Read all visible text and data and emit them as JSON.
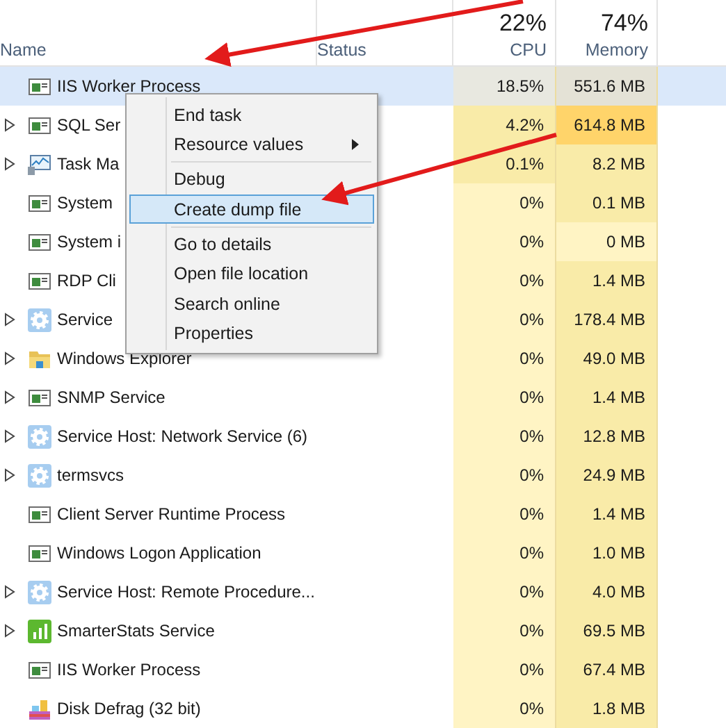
{
  "header": {
    "name": "Name",
    "status": "Status",
    "cpu_total": "22%",
    "cpu": "CPU",
    "memory_total": "74%",
    "memory": "Memory"
  },
  "rows": [
    {
      "name": "IIS Worker Process",
      "kind": "window",
      "expandable": false,
      "selected": true,
      "cpu": {
        "text": "18.5%",
        "color": "#e8e8e0"
      },
      "memory": {
        "text": "551.6 MB",
        "color": "#e4e2d6"
      }
    },
    {
      "name": "SQL Ser",
      "kind": "window",
      "expandable": true,
      "selected": false,
      "cpu": {
        "text": "4.2%",
        "color": "#f9eba8"
      },
      "memory": {
        "text": "614.8 MB",
        "color": "#ffd46a"
      }
    },
    {
      "name": "Task Ma",
      "kind": "monitor",
      "expandable": true,
      "selected": false,
      "cpu": {
        "text": "0.1%",
        "color": "#f9eba8"
      },
      "memory": {
        "text": "8.2 MB",
        "color": "#f9eba8"
      }
    },
    {
      "name": "System",
      "kind": "window",
      "expandable": false,
      "selected": false,
      "cpu": {
        "text": "0%",
        "color": "#fff4c4"
      },
      "memory": {
        "text": "0.1 MB",
        "color": "#f9eba8"
      }
    },
    {
      "name": "System i",
      "kind": "window",
      "expandable": false,
      "selected": false,
      "cpu": {
        "text": "0%",
        "color": "#fff4c4"
      },
      "memory": {
        "text": "0 MB",
        "color": "#fff4c4"
      }
    },
    {
      "name": "RDP Cli",
      "kind": "window",
      "expandable": false,
      "selected": false,
      "cpu": {
        "text": "0%",
        "color": "#fff4c4"
      },
      "memory": {
        "text": "1.4 MB",
        "color": "#f9eba8"
      }
    },
    {
      "name": "Service",
      "kind": "gear",
      "expandable": true,
      "selected": false,
      "cpu": {
        "text": "0%",
        "color": "#fff4c4"
      },
      "memory": {
        "text": "178.4 MB",
        "color": "#f9eba8"
      }
    },
    {
      "name": "Windows Explorer",
      "kind": "folder",
      "expandable": true,
      "selected": false,
      "cpu": {
        "text": "0%",
        "color": "#fff4c4"
      },
      "memory": {
        "text": "49.0 MB",
        "color": "#f9eba8"
      }
    },
    {
      "name": "SNMP Service",
      "kind": "window",
      "expandable": true,
      "selected": false,
      "cpu": {
        "text": "0%",
        "color": "#fff4c4"
      },
      "memory": {
        "text": "1.4 MB",
        "color": "#f9eba8"
      }
    },
    {
      "name": "Service Host: Network Service (6)",
      "kind": "gear",
      "expandable": true,
      "selected": false,
      "cpu": {
        "text": "0%",
        "color": "#fff4c4"
      },
      "memory": {
        "text": "12.8 MB",
        "color": "#f9eba8"
      }
    },
    {
      "name": "termsvcs",
      "kind": "gear",
      "expandable": true,
      "selected": false,
      "cpu": {
        "text": "0%",
        "color": "#fff4c4"
      },
      "memory": {
        "text": "24.9 MB",
        "color": "#f9eba8"
      }
    },
    {
      "name": "Client Server Runtime Process",
      "kind": "window",
      "expandable": false,
      "selected": false,
      "cpu": {
        "text": "0%",
        "color": "#fff4c4"
      },
      "memory": {
        "text": "1.4 MB",
        "color": "#f9eba8"
      }
    },
    {
      "name": "Windows Logon Application",
      "kind": "window",
      "expandable": false,
      "selected": false,
      "cpu": {
        "text": "0%",
        "color": "#fff4c4"
      },
      "memory": {
        "text": "1.0 MB",
        "color": "#f9eba8"
      }
    },
    {
      "name": "Service Host: Remote Procedure...",
      "kind": "gear",
      "expandable": true,
      "selected": false,
      "cpu": {
        "text": "0%",
        "color": "#fff4c4"
      },
      "memory": {
        "text": "4.0 MB",
        "color": "#f9eba8"
      }
    },
    {
      "name": "SmarterStats Service",
      "kind": "bars",
      "expandable": true,
      "selected": false,
      "cpu": {
        "text": "0%",
        "color": "#fff4c4"
      },
      "memory": {
        "text": "69.5 MB",
        "color": "#f9eba8"
      }
    },
    {
      "name": "IIS Worker Process",
      "kind": "window",
      "expandable": false,
      "selected": false,
      "cpu": {
        "text": "0%",
        "color": "#fff4c4"
      },
      "memory": {
        "text": "67.4 MB",
        "color": "#f9eba8"
      }
    },
    {
      "name": "Disk Defrag (32 bit)",
      "kind": "defrag",
      "expandable": false,
      "selected": false,
      "cpu": {
        "text": "0%",
        "color": "#fff4c4"
      },
      "memory": {
        "text": "1.8 MB",
        "color": "#f9eba8"
      }
    }
  ],
  "context_menu": [
    {
      "kind": "item",
      "label": "End task",
      "submenu": false,
      "selected": false
    },
    {
      "kind": "item",
      "label": "Resource values",
      "submenu": true,
      "selected": false
    },
    {
      "kind": "separator"
    },
    {
      "kind": "item",
      "label": "Debug",
      "submenu": false,
      "selected": false
    },
    {
      "kind": "item",
      "label": "Create dump file",
      "submenu": false,
      "selected": true
    },
    {
      "kind": "separator"
    },
    {
      "kind": "item",
      "label": "Go to details",
      "submenu": false,
      "selected": false
    },
    {
      "kind": "item",
      "label": "Open file location",
      "submenu": false,
      "selected": false
    },
    {
      "kind": "item",
      "label": "Search online",
      "submenu": false,
      "selected": false
    },
    {
      "kind": "item",
      "label": "Properties",
      "submenu": false,
      "selected": false
    }
  ]
}
